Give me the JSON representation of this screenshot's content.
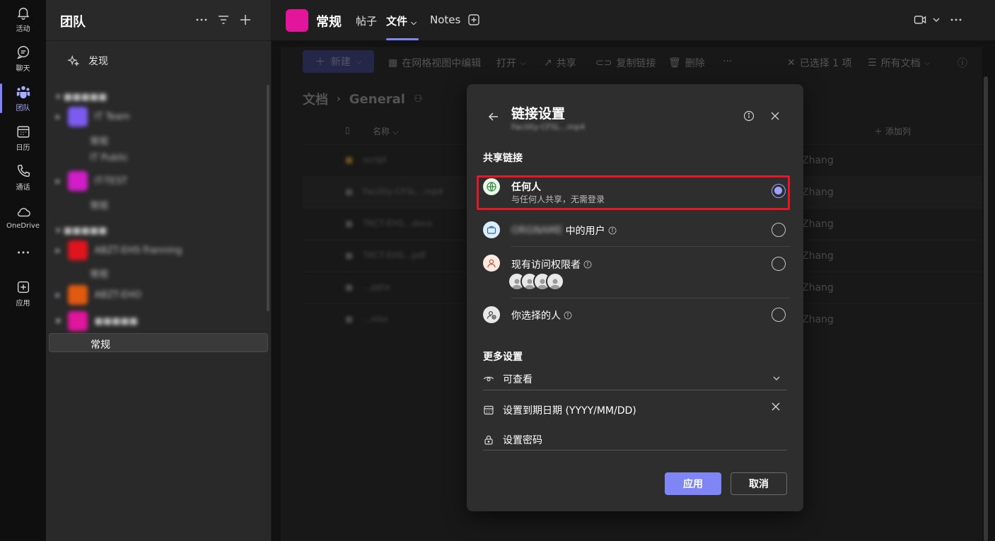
{
  "rail": {
    "items": [
      {
        "label": "活动",
        "icon": "bell-icon"
      },
      {
        "label": "聊天",
        "icon": "chat-icon"
      },
      {
        "label": "团队",
        "icon": "teams-icon"
      },
      {
        "label": "日历",
        "icon": "calendar-icon"
      },
      {
        "label": "通话",
        "icon": "phone-icon"
      },
      {
        "label": "OneDrive",
        "icon": "cloud-icon"
      },
      {
        "label": "应用",
        "icon": "add-app-icon"
      }
    ]
  },
  "panel": {
    "title": "团队",
    "discover": "发现",
    "teams": [
      "IT Team",
      "IT-TEST",
      "ABZT-EHS-Tranning",
      "ABZT-EHO"
    ],
    "sub_items": [
      "常规",
      "IT Public",
      "常规",
      "常规"
    ],
    "selected_channel": "常规"
  },
  "topbar": {
    "channel_name": "常规",
    "tabs": [
      "帖子",
      "文件",
      "Notes"
    ]
  },
  "toolbar": {
    "new_label": "新建",
    "grid_edit": "在网格视图中编辑",
    "open": "打开",
    "share": "共享",
    "copy_link": "复制链接",
    "delete": "删除",
    "selected": "已选择 1 项",
    "all_docs": "所有文档"
  },
  "library": {
    "crumb_root": "文档",
    "crumb_folder": "General",
    "col_name": "名称",
    "add_column": "添加列",
    "rows": [
      {
        "file": "script",
        "owner": "Zhang"
      },
      {
        "file": "Facility-CFSL...mp4",
        "owner": "Zhang"
      },
      {
        "file": "TKCT-EHS...docx",
        "owner": "Zhang"
      },
      {
        "file": "TKCT-EHS...pdf",
        "owner": "Zhang"
      },
      {
        "file": "...pptx",
        "owner": "Zhang"
      },
      {
        "file": "...xlsx",
        "owner": "Zhang"
      }
    ]
  },
  "dialog": {
    "title": "链接设置",
    "subtitle": "Facility-CFSL...mp4",
    "share_link_title": "共享链接",
    "options": [
      {
        "label": "任何人",
        "desc": "与任何人共享，无需登录",
        "selected": true
      },
      {
        "org": "ORGNAME",
        "label": "中的用户",
        "selected": false
      },
      {
        "label": "现有访问权限者",
        "selected": false
      },
      {
        "label": "你选择的人",
        "selected": false
      }
    ],
    "more_settings_title": "更多设置",
    "permission": "可查看",
    "expiry": "设置到期日期 (YYYY/MM/DD)",
    "password": "设置密码",
    "apply": "应用",
    "cancel": "取消"
  },
  "colors": {
    "accent": "#7f85f5",
    "highlight": "#e3192a",
    "channel_avatar": "#e1169a"
  }
}
